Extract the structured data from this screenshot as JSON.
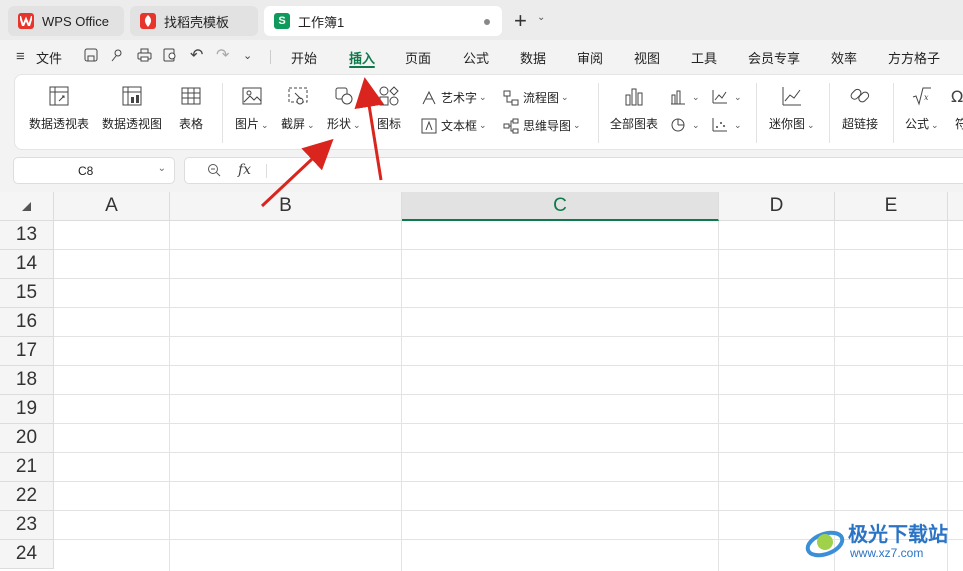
{
  "tabs": [
    {
      "label": "WPS Office",
      "logo": "wps-logo",
      "color": "#e8352b"
    },
    {
      "label": "找稻壳模板",
      "logo": "docer-logo",
      "color": "#e8352b"
    },
    {
      "label": "工作簿1",
      "logo": "S",
      "color": "#0e9a5a"
    }
  ],
  "menu": {
    "file": "文件",
    "items": [
      "开始",
      "插入",
      "页面",
      "公式",
      "数据",
      "审阅",
      "视图",
      "工具",
      "会员专享",
      "效率",
      "方方格子"
    ],
    "active": "插入"
  },
  "ribbon": {
    "pivot_table": "数据透视表",
    "pivot_chart": "数据透视图",
    "table": "表格",
    "picture": "图片",
    "screenshot": "截屏",
    "shape": "形状",
    "icon": "图标",
    "wordart": "艺术字",
    "textbox": "文本框",
    "flowchart": "流程图",
    "mindmap": "思维导图",
    "all_charts": "全部图表",
    "sparkline": "迷你图",
    "hyperlink": "超链接",
    "formula": "公式",
    "symbol": "符"
  },
  "formula_bar": {
    "cell_ref": "C8",
    "fx": "fx"
  },
  "grid": {
    "columns": [
      "A",
      "B",
      "C",
      "D",
      "E"
    ],
    "selected_column": "C",
    "rows": [
      "13",
      "14",
      "15",
      "16",
      "17",
      "18",
      "19",
      "20",
      "21",
      "22",
      "23",
      "24"
    ]
  },
  "watermark": {
    "text": "极光下载站",
    "url": "www.xz7.com"
  },
  "colors": {
    "accent": "#0e7a4b",
    "arrow": "#d9251d"
  }
}
